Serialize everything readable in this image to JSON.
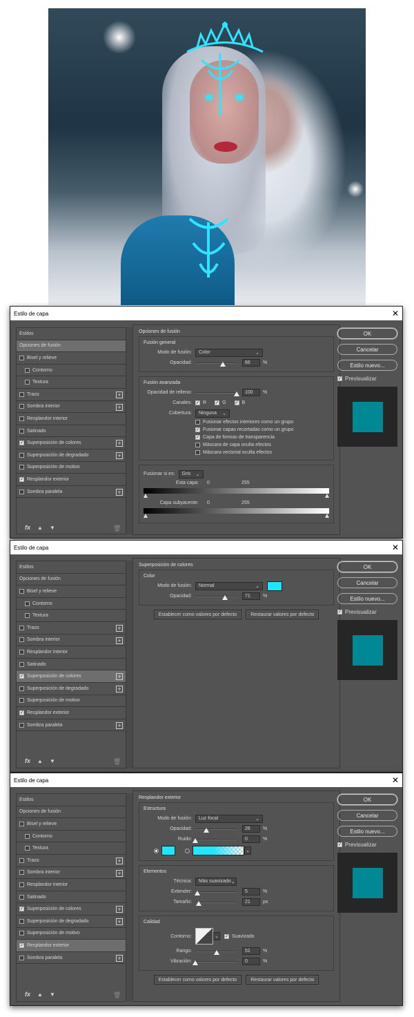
{
  "window_title": "Estilo de capa",
  "close_glyph": "✕",
  "styles_list": {
    "header": "Estilos",
    "items": [
      "Opciones de fusión",
      "Bisel y relieve",
      "Contorno",
      "Textura",
      "Trazo",
      "Sombra interior",
      "Resplandor interior",
      "Satinado",
      "Superposición de colores",
      "Superposición de degradado",
      "Superposición de motivo",
      "Resplandor exterior",
      "Sombra paralela"
    ]
  },
  "footer": {
    "fx_label": "fx",
    "up_icon": "arrow-up-icon",
    "down_icon": "arrow-down-icon",
    "trash_icon": "trash-icon"
  },
  "buttons": {
    "ok": "OK",
    "cancel": "Cancelar",
    "new_style": "Estilo nuevo...",
    "preview": "Previsualizar"
  },
  "preview_color": "#008994",
  "dialog1": {
    "title": "Opciones de fusión",
    "general": {
      "title": "Fusión general",
      "mode_label": "Modo de fusión:",
      "mode_value": "Color",
      "opacity_label": "Opacidad:",
      "opacity_value": "66",
      "pct": "%",
      "opacity": 66
    },
    "advanced": {
      "title": "Fusión avanzada",
      "fill_label": "Opacidad de relleno:",
      "fill_value": "100",
      "fill": 100,
      "channels_label": "Canales:",
      "ch_r": "R",
      "ch_g": "G",
      "ch_b": "B",
      "knockout_label": "Cobertura:",
      "knockout_value": "Ninguna",
      "opts": [
        "Fusionar efectos interiores como un grupo",
        "Fusionar capas recortadas como un grupo",
        "Capa de formas de transparencia",
        "Máscara de capa oculta efectos",
        "Máscara vectorial oculta efectos"
      ],
      "opts_checked": [
        false,
        true,
        true,
        false,
        false
      ]
    },
    "blendif": {
      "label": "Fusionar si es:",
      "value": "Gris",
      "this_layer": "Esta capa:",
      "underlying": "Capa subyacente:",
      "min": "0",
      "max": "255"
    }
  },
  "dialog2": {
    "title": "Superposición de colores",
    "color_group": "Color",
    "mode_label": "Modo de fusión:",
    "mode_value": "Normal",
    "swatch": "#1fe6ff",
    "opacity_label": "Opacidad:",
    "opacity_value": "71",
    "opacity": 71,
    "pct": "%",
    "btn_default": "Establecer como valores por defecto",
    "btn_restore": "Restaurar valores por defecto"
  },
  "dialog3": {
    "title": "Resplandor exterior",
    "structure": "Estructura",
    "mode_label": "Modo de fusión:",
    "mode_value": "Luz focal",
    "opacity_label": "Opacidad:",
    "opacity_value": "26",
    "opacity": 26,
    "noise_label": "Ruido:",
    "noise_value": "0",
    "noise": 0,
    "pct": "%",
    "elements": "Elementos",
    "technique_label": "Técnica:",
    "technique_value": "Más suavizado",
    "spread_label": "Extender:",
    "spread_value": "5",
    "spread": 5,
    "size_label": "Tamaño:",
    "size_value": "21",
    "size": 21,
    "px": "px",
    "quality": "Calidad",
    "contour_label": "Contorno:",
    "antialias": "Suavizado",
    "range_label": "Rango:",
    "range_value": "51",
    "range": 51,
    "jitter_label": "Vibración:",
    "jitter_value": "0",
    "jitter": 0,
    "btn_default": "Establecer como valores por defecto",
    "btn_restore": "Restaurar valores por defecto"
  }
}
